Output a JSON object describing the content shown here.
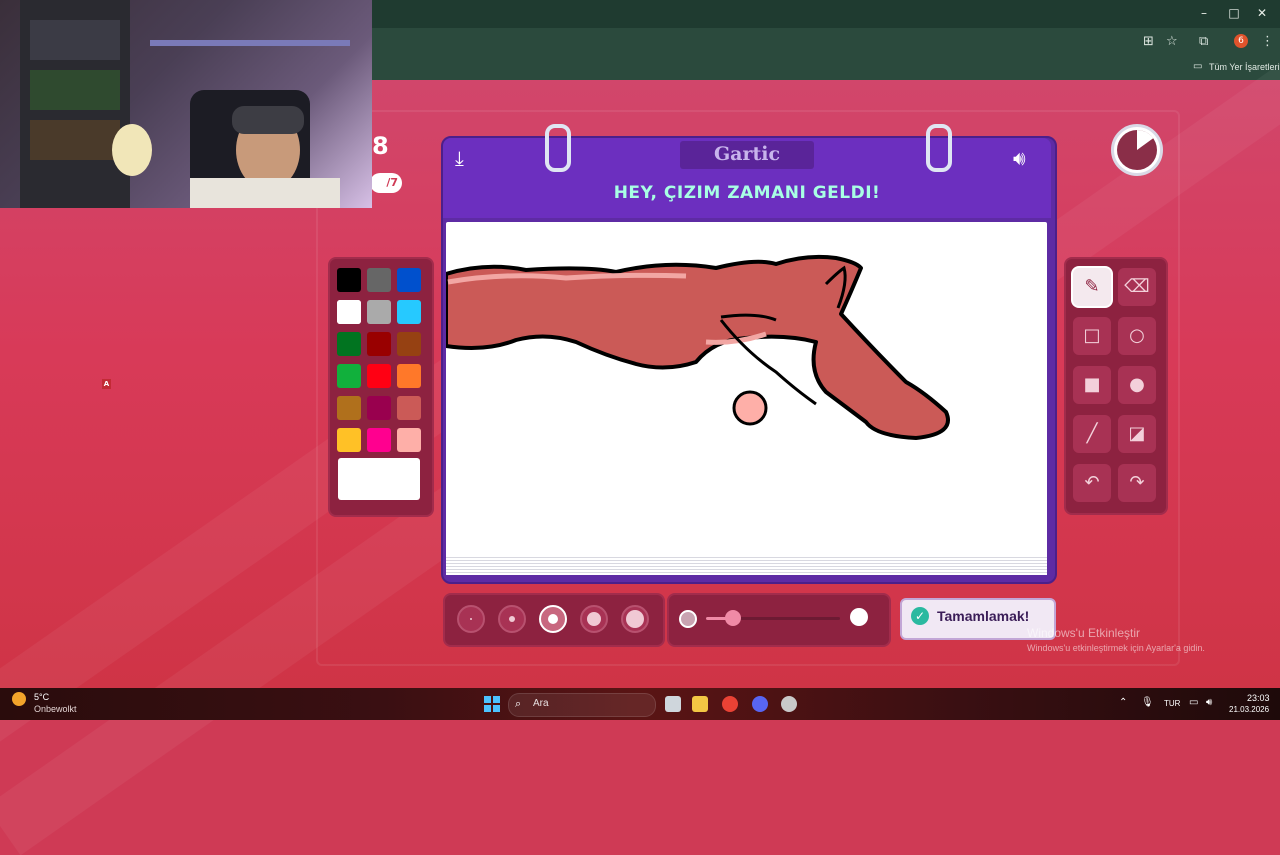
{
  "browser": {
    "bookmarks_label": "Tüm Yer İşaretleri",
    "profile_badge": "6"
  },
  "hud": {
    "score_partial": "8",
    "round_partial": "/7"
  },
  "marker": "A",
  "game": {
    "logo": "Gartic",
    "prompt": "HEY, ÇIZIM ZAMANI GELDI!",
    "done_button": "Tamamlamak!",
    "timer_elapsed_fraction": 0.15,
    "opacity_level": 0.2
  },
  "palette": {
    "colors": [
      "#000000",
      "#666666",
      "#0050cd",
      "#ffffff",
      "#aaaaaa",
      "#26c9ff",
      "#017420",
      "#990000",
      "#964112",
      "#11b03c",
      "#ff0013",
      "#ff7829",
      "#b0701c",
      "#99004e",
      "#cb5a57",
      "#ffc126",
      "#ff008f",
      "#feafa8"
    ],
    "selected_index": 3,
    "current_color": "#ffffff"
  },
  "tools": [
    "pencil-icon",
    "eraser-icon",
    "square-outline-icon",
    "circle-outline-icon",
    "square-fill-icon",
    "circle-fill-icon",
    "line-icon",
    "fill-bucket-icon",
    "undo-icon",
    "redo-icon"
  ],
  "brush_sizes": {
    "count": 5,
    "selected_index": 2
  },
  "watermark": {
    "title": "Windows'u Etkinleştir",
    "subtitle": "Windows'u etkinleştirmek için Ayarlar'a gidin."
  },
  "taskbar": {
    "weather_temp": "5°C",
    "weather_desc": "Onbewolkt",
    "search_label": "Ara",
    "language": "TUR",
    "time": "23:03",
    "date": "21.03.2026"
  }
}
